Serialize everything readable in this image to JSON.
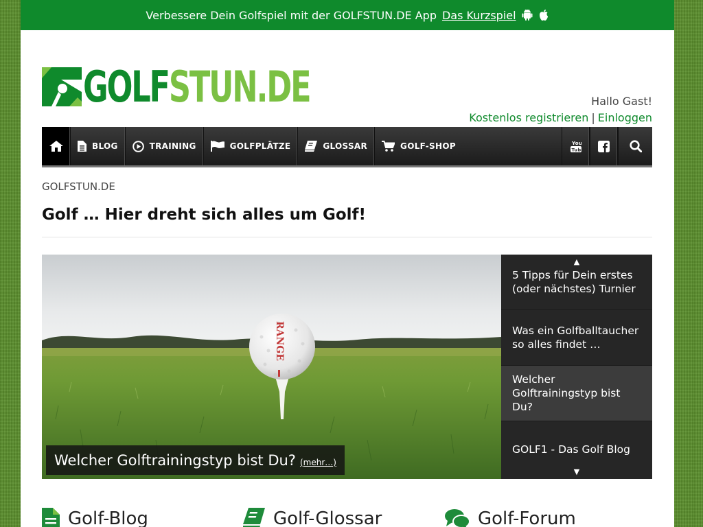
{
  "promo": {
    "text": "Verbessere Dein Golfspiel mit der GOLFSTUN.DE App",
    "link": "Das Kurzspiel",
    "icons": [
      "android-icon",
      "apple-icon"
    ]
  },
  "header": {
    "logo_part1": "GOLF",
    "logo_part2": "STUN.DE",
    "greeting": "Hallo Gast!",
    "register": "Kostenlos registrieren",
    "separator": "|",
    "login": "Einloggen"
  },
  "nav": {
    "home_icon": "home-icon",
    "items": [
      {
        "label": "BLOG",
        "icon": "document-icon"
      },
      {
        "label": "TRAINING",
        "icon": "play-icon"
      },
      {
        "label": "GOLFPLÄTZE",
        "icon": "flag-icon"
      },
      {
        "label": "GLOSSAR",
        "icon": "book-icon"
      },
      {
        "label": "GOLF-SHOP",
        "icon": "cart-icon"
      }
    ],
    "right_icons": [
      "youtube-icon",
      "facebook-icon",
      "search-icon"
    ]
  },
  "breadcrumb": "GOLFSTUN.DE",
  "title": "Golf … Hier dreht sich alles um Golf!",
  "slider": {
    "caption": "Welcher Golftrainingstyp bist Du?",
    "more": "(mehr…)",
    "up_arrow": "▲",
    "down_arrow": "▼",
    "entries": [
      "5 Tipps für Dein erstes (oder nächstes) Turnier",
      "Was ein Golfballtaucher so alles findet …",
      "Welcher Golftrainingstyp bist Du?",
      "GOLF1 - Das Golf Blog"
    ],
    "active_index": 2,
    "ball_text": "RANGE"
  },
  "sections": [
    "Golf-Blog",
    "Golf-Glossar",
    "Golf-Forum"
  ],
  "colors": {
    "brand_dark": "#0f8a2c",
    "brand_light": "#7bc043",
    "nav_bg": "#222222"
  }
}
